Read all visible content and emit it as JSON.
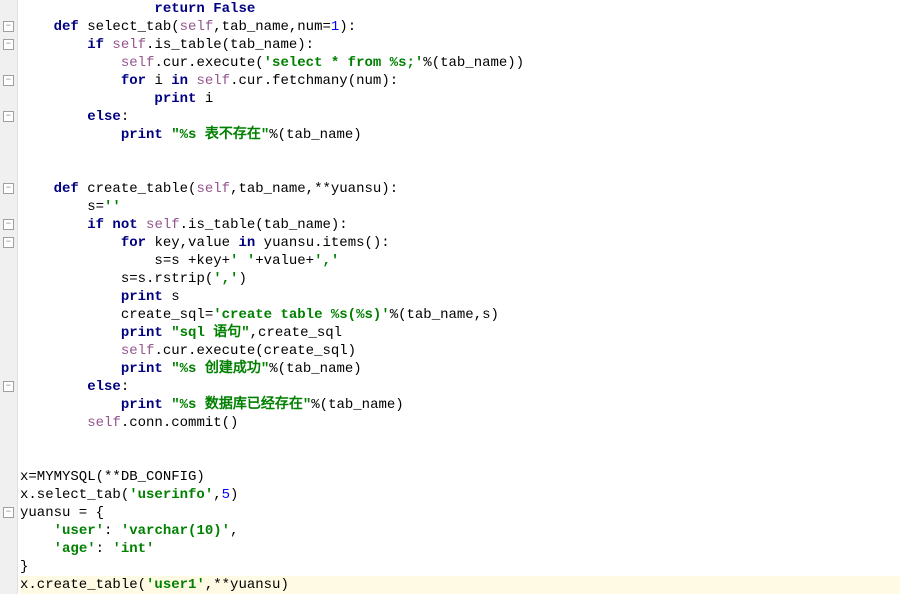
{
  "code": {
    "l1_kw_return": "return",
    "l1_kw_false": "False",
    "l2_kw_def": "def",
    "l2_fn": " select_tab(",
    "l2_self": "self",
    "l2_rest": ",tab_name,num=",
    "l2_num": "1",
    "l2_close": "):",
    "l3_kw_if": "if",
    "l3_self": " self",
    "l3_rest": ".is_table(tab_name):",
    "l4_self": "self",
    "l4_mid": ".cur.execute(",
    "l4_str": "'select * from %s;'",
    "l4_end": "%(tab_name))",
    "l5_kw_for": "for",
    "l5_mid": " i ",
    "l5_kw_in": "in",
    "l5_self": " self",
    "l5_end": ".cur.fetchmany(num):",
    "l6_kw_print": "print",
    "l6_end": " i",
    "l7_kw_else": "else",
    "l7_colon": ":",
    "l8_kw_print": "print",
    "l8_str": " \"%s 表不存在\"",
    "l8_end": "%(tab_name)",
    "l11_kw_def": "def",
    "l11_fn": " create_table(",
    "l11_self": "self",
    "l11_end": ",tab_name,**yuansu):",
    "l12_s": "s=",
    "l12_str": "''",
    "l13_kw_if": "if",
    "l13_kw_not": " not",
    "l13_self": " self",
    "l13_end": ".is_table(tab_name):",
    "l14_kw_for": "for",
    "l14_mid": " key,value ",
    "l14_kw_in": "in",
    "l14_end": " yuansu.items():",
    "l15_pre": "s=s +key+",
    "l15_str1": "' '",
    "l15_plus": "+value+",
    "l15_str2": "','",
    "l16_pre": "s=s.rstrip(",
    "l16_str": "','",
    "l16_close": ")",
    "l17_kw_print": "print",
    "l17_end": " s",
    "l18_pre": "create_sql=",
    "l18_str": "'create table %s(%s)'",
    "l18_end": "%(tab_name,s)",
    "l19_kw_print": "print",
    "l19_str": " \"sql 语句\"",
    "l19_end": ",create_sql",
    "l20_self": "self",
    "l20_end": ".cur.execute(create_sql)",
    "l21_kw_print": "print",
    "l21_str": " \"%s 创建成功\"",
    "l21_end": "%(tab_name)",
    "l22_kw_else": "else",
    "l22_colon": ":",
    "l23_kw_print": "print",
    "l23_str": " \"%s 数据库已经存在\"",
    "l23_end": "%(tab_name)",
    "l24_self": "self",
    "l24_end": ".conn.commit()",
    "l27": "x=MYMYSQL(**DB_CONFIG)",
    "l28_pre": "x.select_tab(",
    "l28_str": "'userinfo'",
    "l28_comma": ",",
    "l28_num": "5",
    "l28_close": ")",
    "l29": "yuansu = {",
    "l30_str1": "'user'",
    "l30_colon": ": ",
    "l30_str2": "'varchar(10)'",
    "l30_comma": ",",
    "l31_str1": "'age'",
    "l31_colon": ": ",
    "l31_str2": "'int'",
    "l32": "}",
    "l33_pre": "x.create_table(",
    "l33_str": "'user1'",
    "l33_end": ",**yuansu)"
  },
  "fold": {
    "minus": "−"
  }
}
